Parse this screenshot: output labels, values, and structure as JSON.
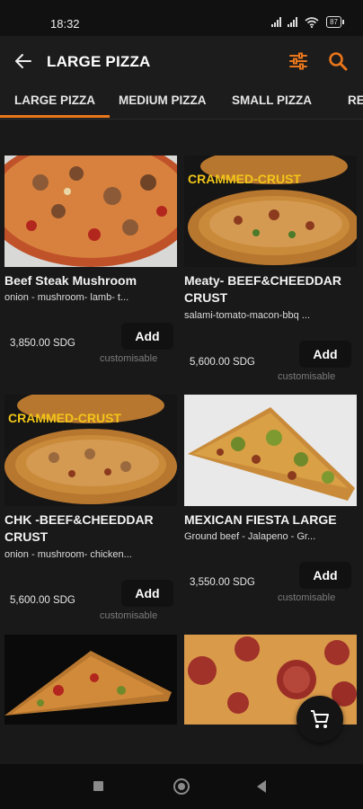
{
  "status": {
    "time": "18:32",
    "battery": "87"
  },
  "header": {
    "title": "LARGE PIZZA"
  },
  "tabs": [
    "LARGE PIZZA",
    "MEDIUM PIZZA",
    "SMALL PIZZA",
    "RE"
  ],
  "colors": {
    "accent": "#e8761b",
    "background": "#1a1a1a",
    "button": "#111111"
  },
  "products": [
    {
      "name": "Beef Steak Mushroom",
      "description": "onion - mushroom- lamb- t...",
      "price": "3,850.00 SDG",
      "add_label": "Add",
      "customisable": "customisable",
      "image_icon": "pizza-photo"
    },
    {
      "name": "Meaty- BEEF&CHEEDDAR CRUST",
      "description": "salami-tomato-macon-bbq ...",
      "price": "5,600.00 SDG",
      "add_label": "Add",
      "customisable": "customisable",
      "image_icon": "pizza-photo",
      "image_text": "CRAMMED-CRUST"
    },
    {
      "name": "CHK -BEEF&CHEEDDAR CRUST",
      "description": "onion - mushroom- chicken...",
      "price": "5,600.00 SDG",
      "add_label": "Add",
      "customisable": "customisable",
      "image_icon": "pizza-photo",
      "image_text": "CRAMMED-CRUST"
    },
    {
      "name": "MEXICAN FIESTA LARGE",
      "description": "Ground beef - Jalapeno - Gr...",
      "price": "3,550.00 SDG",
      "add_label": "Add",
      "customisable": "customisable",
      "image_icon": "pizza-slice-photo"
    },
    {
      "image_icon": "pizza-slice-photo"
    },
    {
      "image_icon": "sausage-pizza-photo"
    }
  ],
  "icons": {
    "back": "arrow-left-icon",
    "filter": "sliders-icon",
    "search": "search-icon",
    "cart": "cart-icon"
  }
}
